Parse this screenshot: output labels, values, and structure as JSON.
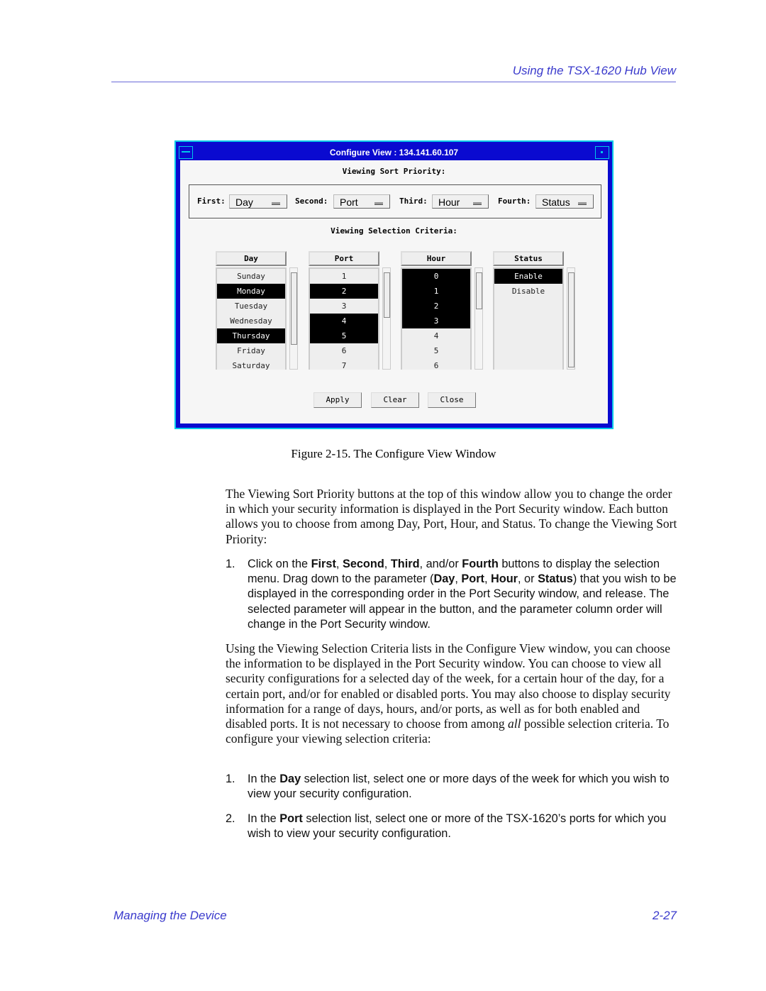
{
  "header": {
    "running_title": "Using the TSX-1620 Hub View"
  },
  "window": {
    "title": "Configure View : 134.141.60.107",
    "sort_heading": "Viewing Sort Priority:",
    "sort": [
      {
        "label": "First:",
        "value": "Day"
      },
      {
        "label": "Second:",
        "value": "Port"
      },
      {
        "label": "Third:",
        "value": "Hour"
      },
      {
        "label": "Fourth:",
        "value": "Status"
      }
    ],
    "criteria_heading": "Viewing Selection Criteria:",
    "lists": [
      {
        "header": "Day",
        "items": [
          {
            "t": "Sunday",
            "sel": false
          },
          {
            "t": "Monday",
            "sel": true
          },
          {
            "t": "Tuesday",
            "sel": false
          },
          {
            "t": "Wednesday",
            "sel": false
          },
          {
            "t": "Thursday",
            "sel": true
          },
          {
            "t": "Friday",
            "sel": false
          },
          {
            "t": "Saturday",
            "sel": false
          }
        ]
      },
      {
        "header": "Port",
        "items": [
          {
            "t": "1",
            "sel": false
          },
          {
            "t": "2",
            "sel": true
          },
          {
            "t": "3",
            "sel": false
          },
          {
            "t": "4",
            "sel": true
          },
          {
            "t": "5",
            "sel": true
          },
          {
            "t": "6",
            "sel": false
          },
          {
            "t": "7",
            "sel": false
          }
        ]
      },
      {
        "header": "Hour",
        "items": [
          {
            "t": "0",
            "sel": true
          },
          {
            "t": "1",
            "sel": true
          },
          {
            "t": "2",
            "sel": true
          },
          {
            "t": "3",
            "sel": true
          },
          {
            "t": "4",
            "sel": false
          },
          {
            "t": "5",
            "sel": false
          },
          {
            "t": "6",
            "sel": false
          }
        ]
      },
      {
        "header": "Status",
        "items": [
          {
            "t": "Enable",
            "sel": true
          },
          {
            "t": "Disable",
            "sel": false
          }
        ]
      }
    ],
    "buttons": {
      "apply": "Apply",
      "clear": "Clear",
      "close": "Close"
    }
  },
  "caption": "Figure 2-15.  The Configure View Window",
  "body": [
    {
      "type": "p",
      "segs": [
        {
          "t": "The Viewing Sort Priority buttons at the top of this window allow you to change the order in which your security information is displayed in the Port Security window. Each button allows you to choose from among Day, Port, Hour, and Status. To change the Viewing Sort Priority:"
        }
      ]
    },
    {
      "type": "li",
      "num": "1.",
      "segs": [
        {
          "t": "Click on the "
        },
        {
          "t": "First",
          "b": true
        },
        {
          "t": ", "
        },
        {
          "t": "Second",
          "b": true
        },
        {
          "t": ", "
        },
        {
          "t": "Third",
          "b": true
        },
        {
          "t": ", and/or "
        },
        {
          "t": "Fourth",
          "b": true
        },
        {
          "t": " buttons to display the selection menu. Drag down to the parameter ("
        },
        {
          "t": "Day",
          "b": true
        },
        {
          "t": ", "
        },
        {
          "t": "Port",
          "b": true
        },
        {
          "t": ", "
        },
        {
          "t": "Hour",
          "b": true
        },
        {
          "t": ", or "
        },
        {
          "t": "Status",
          "b": true
        },
        {
          "t": ") that you wish to be displayed in the corresponding order in the Port Security window, and release. The selected parameter will appear in the button, and the parameter column order will change in the Port Security window."
        }
      ]
    },
    {
      "type": "p",
      "segs": [
        {
          "t": "Using the Viewing Selection Criteria lists in the Configure View window, you can choose the information to be displayed in the Port Security window. You can choose to view all security configurations for a selected day of the week, for a certain hour of the day, for a certain port, and/or for enabled or disabled ports. You may also choose to display security information for a range of days, hours, and/or ports, as well as for both enabled and disabled ports. It is not necessary to choose from among "
        },
        {
          "t": "all",
          "i": true
        },
        {
          "t": " possible selection criteria. To configure your viewing selection criteria:"
        }
      ]
    },
    {
      "type": "li",
      "num": "1.",
      "segs": [
        {
          "t": "In the "
        },
        {
          "t": "Day",
          "b": true
        },
        {
          "t": " selection list, select one or more days of the week for which you wish to view your security configuration."
        }
      ]
    },
    {
      "type": "li",
      "num": "2.",
      "segs": [
        {
          "t": "In the "
        },
        {
          "t": "Port",
          "b": true
        },
        {
          "t": " selection list, select one or more of the TSX-1620’s ports for which you wish to view your security configuration."
        }
      ]
    }
  ],
  "footer": {
    "left": "Managing the Device",
    "right": "2-27"
  }
}
